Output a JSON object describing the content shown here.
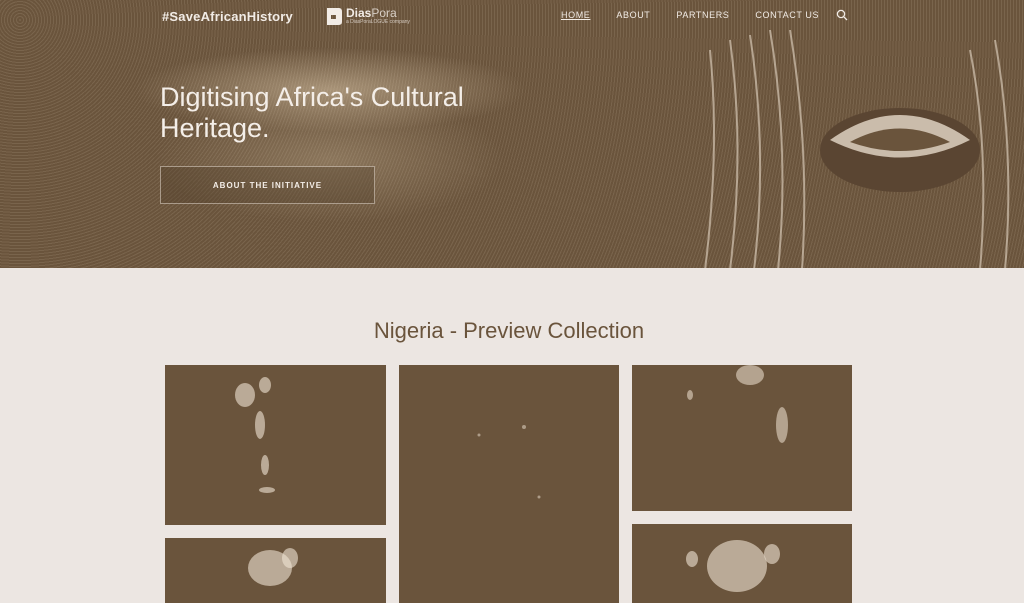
{
  "header": {
    "brand": "#SaveAfricanHistory",
    "logo_name": "Dias",
    "logo_name_suffix": "Pora",
    "logo_tagline": "a DiasPoraLOGUE company",
    "nav": [
      {
        "label": "HOME",
        "active": true
      },
      {
        "label": "ABOUT",
        "active": false
      },
      {
        "label": "PARTNERS",
        "active": false
      },
      {
        "label": "CONTACT US",
        "active": false
      }
    ],
    "search_icon": "search-icon"
  },
  "hero": {
    "title": "Digitising Africa's Cultural Heritage.",
    "button_label": "ABOUT THE INITIATIVE"
  },
  "collection": {
    "title": "Nigeria - Preview Collection",
    "tiles": [
      {
        "name": "collection-image-1"
      },
      {
        "name": "collection-image-2"
      },
      {
        "name": "collection-image-3"
      },
      {
        "name": "collection-image-4"
      },
      {
        "name": "collection-image-5"
      }
    ]
  },
  "colors": {
    "brand_brown": "#6a543c",
    "page_background": "#ece6e2",
    "light_text": "#f4eee8"
  }
}
